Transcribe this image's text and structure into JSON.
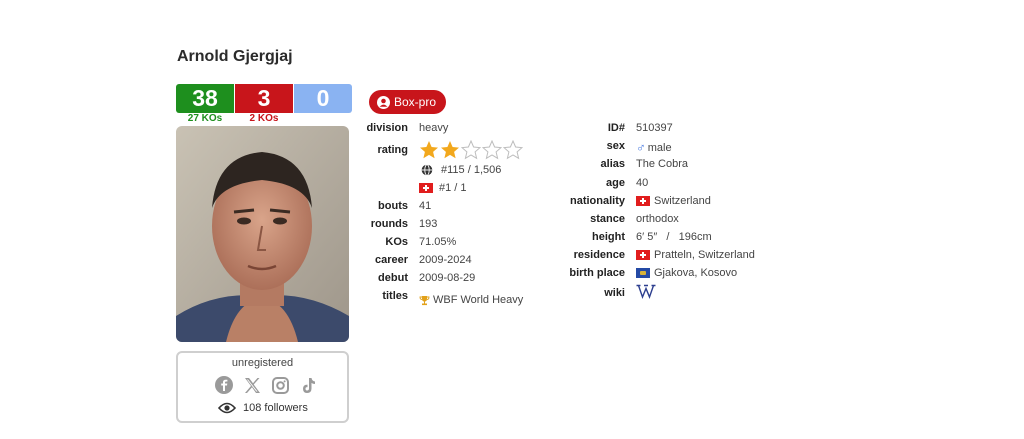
{
  "boxer": {
    "name": "Arnold Gjergjaj"
  },
  "record": {
    "wins": "38",
    "losses": "3",
    "draws": "0",
    "win_kos": "27 KOs",
    "loss_kos": "2 KOs"
  },
  "photo_alt": "Arnold Gjergjaj",
  "social": {
    "status": "unregistered",
    "icons": [
      "facebook-icon",
      "x-icon",
      "instagram-icon",
      "tiktok-icon"
    ],
    "followers": "108 followers"
  },
  "badge": {
    "label": "Box-pro"
  },
  "left_details": {
    "division_label": "division",
    "division": "heavy",
    "rating_label": "rating",
    "rating_stars": 2,
    "rating_max": 5,
    "world_rank": "#115 / 1,506",
    "country_rank": "#1 / 1",
    "bouts_label": "bouts",
    "bouts": "41",
    "rounds_label": "rounds",
    "rounds": "193",
    "kos_label": "KOs",
    "kos": "71.05%",
    "career_label": "career",
    "career": "2009-2024",
    "debut_label": "debut",
    "debut": "2009-08-29",
    "titles_label": "titles",
    "titles": "WBF World Heavy"
  },
  "right_details": {
    "id_label": "ID#",
    "id": "510397",
    "sex_label": "sex",
    "sex": "male",
    "alias_label": "alias",
    "alias": "The Cobra",
    "age_label": "age",
    "age": "40",
    "nationality_label": "nationality",
    "nationality": "Switzerland",
    "stance_label": "stance",
    "stance": "orthodox",
    "height_label": "height",
    "height": "6′ 5″   /   196cm",
    "residence_label": "residence",
    "residence": "Pratteln, Switzerland",
    "birthplace_label": "birth place",
    "birthplace": "Gjakova, Kosovo",
    "wiki_label": "wiki"
  },
  "colors": {
    "win": "#1e8f1e",
    "loss": "#c8151b",
    "draw": "#8ab3f2",
    "star": "#f2a81d",
    "badge": "#c8151b"
  }
}
